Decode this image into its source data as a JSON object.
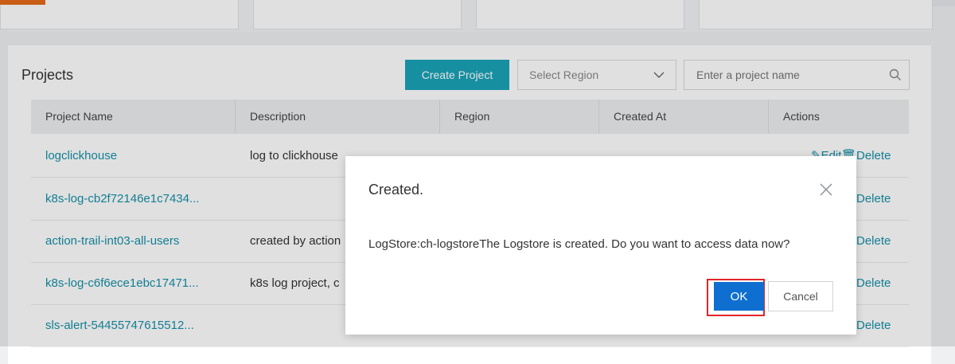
{
  "projects": {
    "title": "Projects",
    "create_button": "Create Project",
    "region_select": {
      "placeholder": "Select Region"
    },
    "search": {
      "placeholder": "Enter a project name"
    },
    "columns": [
      "Project Name",
      "Description",
      "Region",
      "Created At",
      "Actions"
    ],
    "rows": [
      {
        "name": "logclickhouse",
        "description": "log to clickhouse",
        "edit": "Edit",
        "delete": "Delete"
      },
      {
        "name": "k8s-log-cb2f72146e1c7434...",
        "description": "",
        "delete": "Delete"
      },
      {
        "name": "action-trail-int03-all-users",
        "description": "created by action",
        "delete": "Delete"
      },
      {
        "name": "k8s-log-c6f6ece1ebc17471...",
        "description": "k8s log project, c",
        "delete": "Delete"
      },
      {
        "name": "sls-alert-54455747615512...",
        "description": "",
        "delete": "Delete"
      }
    ]
  },
  "dialog": {
    "title": "Created.",
    "message": "LogStore:ch-logstoreThe Logstore is created. Do you want to access data now?",
    "ok": "OK",
    "cancel": "Cancel"
  },
  "colors": {
    "accent": "#1aa3b8",
    "link": "#1590a8",
    "primary": "#0f6fd0",
    "highlight": "#e0262a",
    "top_tab": "#e56a1a"
  }
}
